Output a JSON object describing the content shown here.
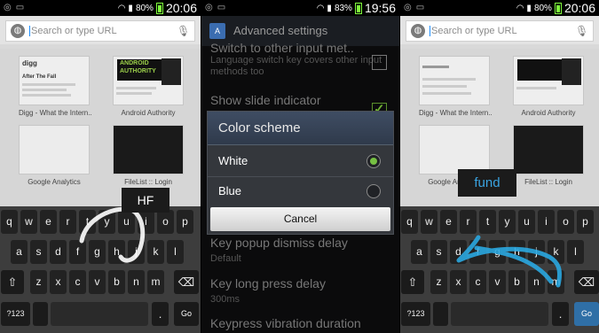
{
  "screens": [
    {
      "status": {
        "battery": "80%",
        "time": "20:06"
      },
      "url_placeholder": "Search or type URL",
      "thumbnails": [
        "Digg - What the Intern..",
        "Android Authority",
        "Google Analytics",
        "FileList :: Login"
      ],
      "digg_head": "digg",
      "digg_story": "After The Fall",
      "aa_logo": "ANDROID AUTHORITY",
      "popup": "HF",
      "go_key": "Go"
    },
    {
      "status": {
        "battery": "83%",
        "time": "19:56"
      },
      "title": "Advanced settings",
      "settings": [
        {
          "title": "Switch to other input met..",
          "summary": "Language switch key covers other input methods too"
        },
        {
          "title": "Show slide indicator",
          "summary": ""
        },
        {
          "title": "Key popup dismiss delay",
          "summary": "Default"
        },
        {
          "title": "Key long press delay",
          "summary": "300ms"
        },
        {
          "title": "Keypress vibration duration",
          "summary": ""
        }
      ],
      "dialog": {
        "title": "Color scheme",
        "options": [
          "White",
          "Blue"
        ],
        "selected": "White",
        "cancel": "Cancel"
      }
    },
    {
      "status": {
        "battery": "80%",
        "time": "20:06"
      },
      "url_placeholder": "Search or type URL",
      "thumbnails": [
        "Digg - What the Intern..",
        "Android Authority",
        "Google Analytics",
        "FileList :: Login"
      ],
      "popup": "fund",
      "go_key": "Go"
    }
  ],
  "keyboard": {
    "row1": [
      "q",
      "w",
      "e",
      "r",
      "t",
      "y",
      "u",
      "i",
      "o",
      "p"
    ],
    "row2": [
      "a",
      "s",
      "d",
      "f",
      "g",
      "h",
      "j",
      "k",
      "l"
    ],
    "row3": [
      "z",
      "x",
      "c",
      "v",
      "b",
      "n",
      "m"
    ],
    "shift": "⇧",
    "backspace": "⌫",
    "symbols": "?123",
    "period": "."
  },
  "colors": {
    "accent_green": "#76c043",
    "swipe_blue": "#2aa7e0",
    "go_blue": "#2f6fa6"
  }
}
